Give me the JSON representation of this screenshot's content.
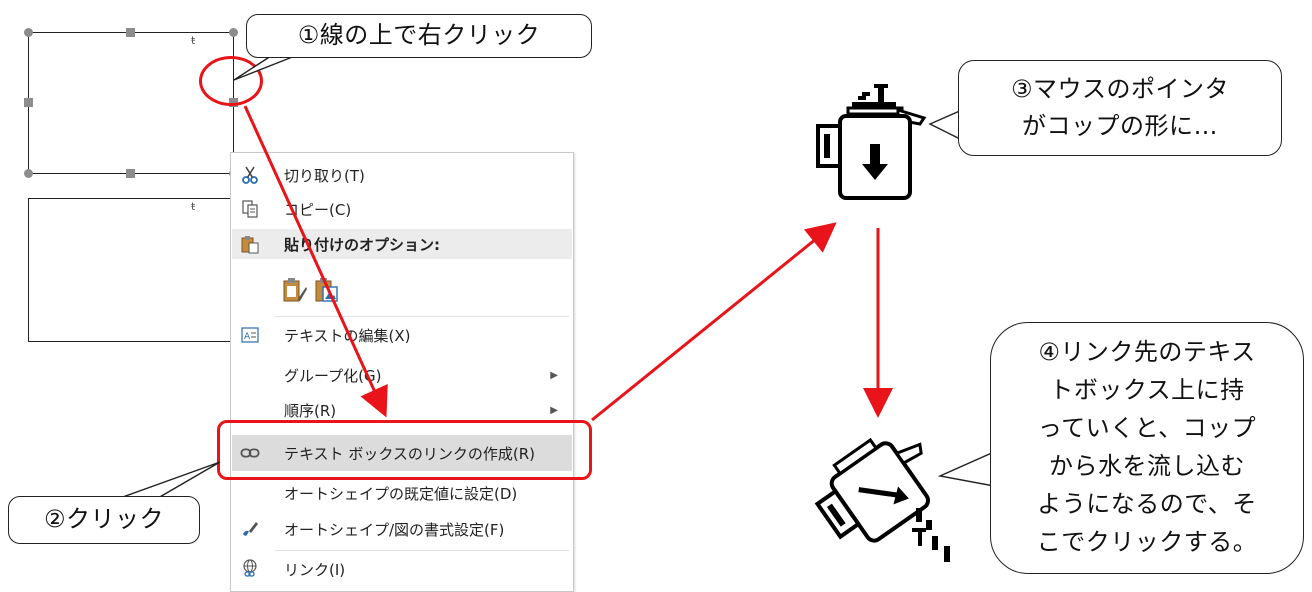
{
  "callouts": {
    "step1": "①線の上で右クリック",
    "step2": "②クリック",
    "step3_line1": "③マウスのポインタ",
    "step3_line2": "がコップの形に…",
    "step4_line1": "④リンク先のテキス",
    "step4_line2": "トボックス上に持",
    "step4_line3": "っていくと、コップ",
    "step4_line4": "から水を流し込む",
    "step4_line5": "ようになるので、そ",
    "step4_line6": "こでクリックする。"
  },
  "textboxes": {
    "mark": "ŧ"
  },
  "context_menu": {
    "cut": "切り取り(T)",
    "copy": "コピー(C)",
    "paste_options": "貼り付けのオプション:",
    "edit_text": "テキストの編集(X)",
    "group": "グループ化(G)",
    "order": "順序(R)",
    "create_link": "テキスト ボックスのリンクの作成(R)",
    "set_default": "オートシェイプの既定値に設定(D)",
    "format_shape": "オートシェイプ/図の書式設定(F)",
    "link": "リンク(I)"
  },
  "icons": {
    "cut": "scissors-icon",
    "copy": "copy-icon",
    "paste": "clipboard-icon",
    "edit_text": "text-edit-icon",
    "create_link": "chain-link-icon",
    "format_shape": "format-brush-icon",
    "link": "globe-link-icon",
    "pitcher_upright": "pitcher-cursor-icon",
    "pitcher_pour": "pouring-pitcher-cursor-icon"
  },
  "colors": {
    "accent_red": "#e8141a",
    "highlight": "#dcdcdc",
    "handle": "#8c8c8c"
  }
}
